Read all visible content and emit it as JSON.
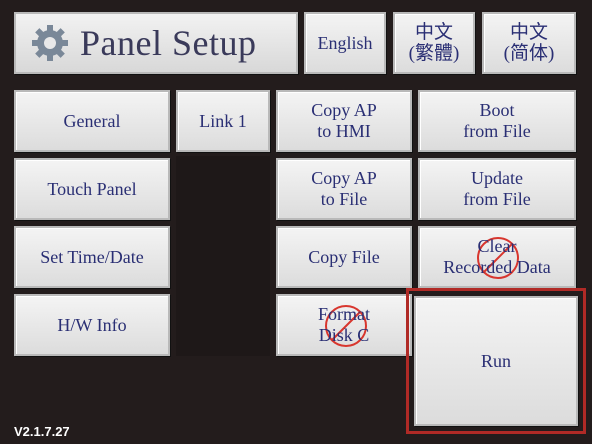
{
  "header": {
    "title": "Panel Setup",
    "languages": [
      {
        "label": "English"
      },
      {
        "label": "中文\n(繁體)"
      },
      {
        "label": "中文\n(简体)"
      }
    ]
  },
  "menu": {
    "general": "General",
    "touch_panel": "Touch Panel",
    "set_time_date": "Set Time/Date",
    "hw_info": "H/W Info",
    "link1": "Link 1",
    "copy_ap_hmi": "Copy AP\nto HMI",
    "copy_ap_file": "Copy AP\nto File",
    "copy_file": "Copy File",
    "format_disk": "Format\nDisk C",
    "boot_from_file": "Boot\nfrom File",
    "update_from_file": "Update\nfrom File",
    "clear_recorded": "Clear\nRecorded Data",
    "run": "Run"
  },
  "status": {
    "version": "V2.1.7.27",
    "disabled_indicator_color": "#d8362e",
    "highlight_color": "#b02a26"
  },
  "icons": {
    "logo": "gear-icon",
    "disabled": "prohibited-icon"
  }
}
